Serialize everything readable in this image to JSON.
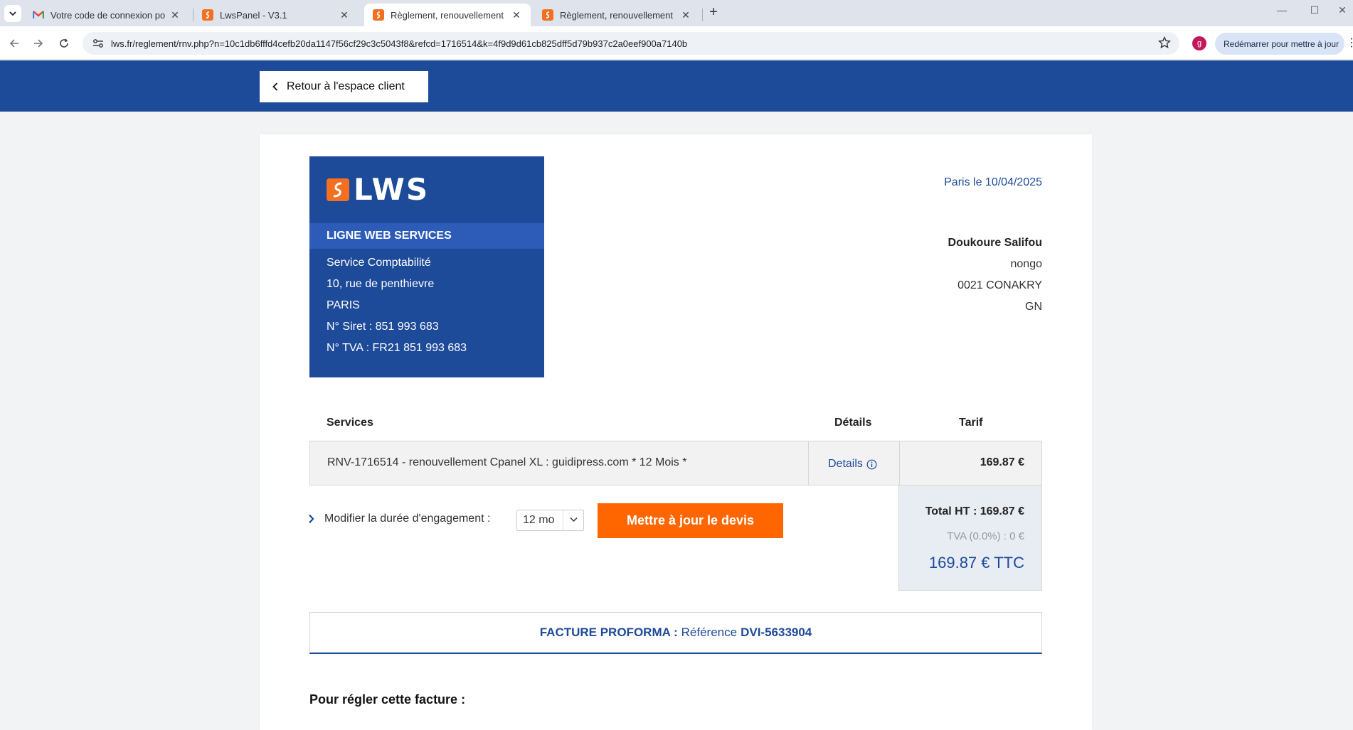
{
  "browser": {
    "tabs": [
      {
        "title": "Votre code de connexion pour :",
        "favicon": "gmail-icon"
      },
      {
        "title": "LwsPanel - V3.1",
        "favicon": "lws-icon"
      },
      {
        "title": "Règlement, renouvellement d'u",
        "favicon": "lws-icon"
      },
      {
        "title": "Règlement, renouvellement d'u",
        "favicon": "lws-icon"
      }
    ],
    "active_tab": 2,
    "url": "lws.fr/reglement/rnv.php?n=10c1db6fffd4cefb20da1147f56cf29c3c5043f8&refcd=1716514&k=4f9d9d61cb825dff5d79b937c2a0eef900a7140b",
    "profile_initial": "g",
    "update_label": "Redémarrer pour mettre à jour"
  },
  "page": {
    "back_label": "Retour à l'espace client",
    "company": {
      "logo_text": "LWS",
      "name": "LIGNE WEB SERVICES",
      "address": [
        "Service Comptabilité",
        "10, rue de penthievre",
        "PARIS",
        "N° Siret : 851 993 683",
        "N° TVA : FR21 851 993 683"
      ]
    },
    "date": "Paris le 10/04/2025",
    "client": {
      "name": "Doukoure Salifou",
      "lines": [
        "nongo",
        "0021 CONAKRY",
        "GN"
      ]
    },
    "table": {
      "headers": {
        "services": "Services",
        "details": "Détails",
        "tarif": "Tarif"
      },
      "rows": [
        {
          "description": "RNV-1716514 - renouvellement Cpanel XL : guidipress.com * 12 Mois *",
          "details": "Details",
          "price": "169.87 €"
        }
      ]
    },
    "totals": {
      "ht": "Total HT : 169.87 €",
      "tva": "TVA (0.0%) : 0 €",
      "ttc": "169.87 € TTC"
    },
    "duration": {
      "label": "Modifier la durée d'engagement :",
      "selected": "12 mo"
    },
    "update_quote_label": "Mettre à jour le devis",
    "proforma": {
      "label": "FACTURE PROFORMA :",
      "ref_label": "Référence",
      "ref": "DVI-5633904"
    },
    "pay_title": "Pour régler cette facture :"
  },
  "colors": {
    "brand_blue": "#1d4a99",
    "brand_orange": "#ff6600",
    "band_blue": "#2c5cb8"
  }
}
